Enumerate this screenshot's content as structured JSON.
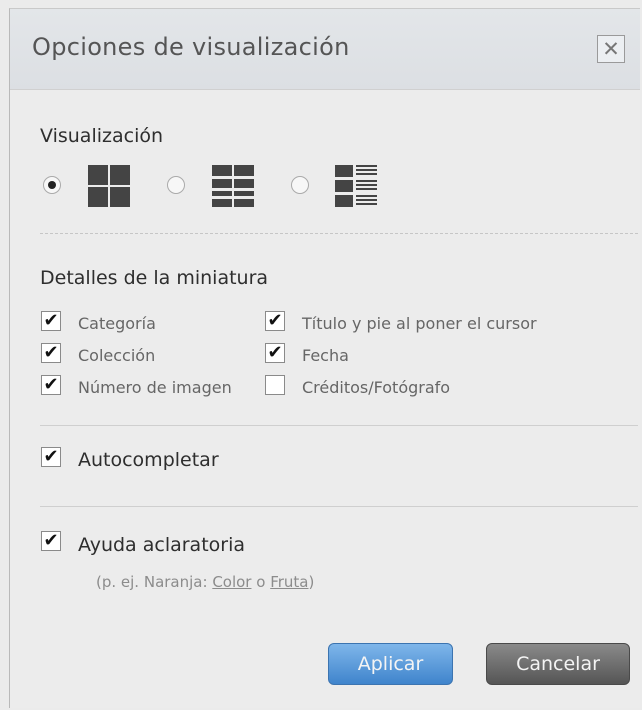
{
  "dialog": {
    "title": "Opciones de visualización",
    "close_icon": "close-icon"
  },
  "view": {
    "heading": "Visualización",
    "selected": 0,
    "options": [
      {
        "icon": "grid-large-icon"
      },
      {
        "icon": "grid-small-icon"
      },
      {
        "icon": "list-icon"
      }
    ]
  },
  "thumbnail": {
    "heading": "Detalles de la miniatura",
    "options": [
      {
        "label": "Categoría",
        "checked": true
      },
      {
        "label": "Título y pie al poner el cursor",
        "checked": true
      },
      {
        "label": "Colección",
        "checked": true
      },
      {
        "label": "Fecha",
        "checked": true
      },
      {
        "label": "Número de imagen",
        "checked": true
      },
      {
        "label": "Créditos/Fotógrafo",
        "checked": false
      }
    ]
  },
  "autocomplete": {
    "label": "Autocompletar",
    "checked": true
  },
  "help": {
    "label": "Ayuda aclaratoria",
    "checked": true,
    "hint_prefix": "(p. ej. Naranja: ",
    "hint_link1": "Color",
    "hint_mid": " o ",
    "hint_link2": "Fruta",
    "hint_suffix": ")"
  },
  "buttons": {
    "apply": "Aplicar",
    "cancel": "Cancelar"
  }
}
